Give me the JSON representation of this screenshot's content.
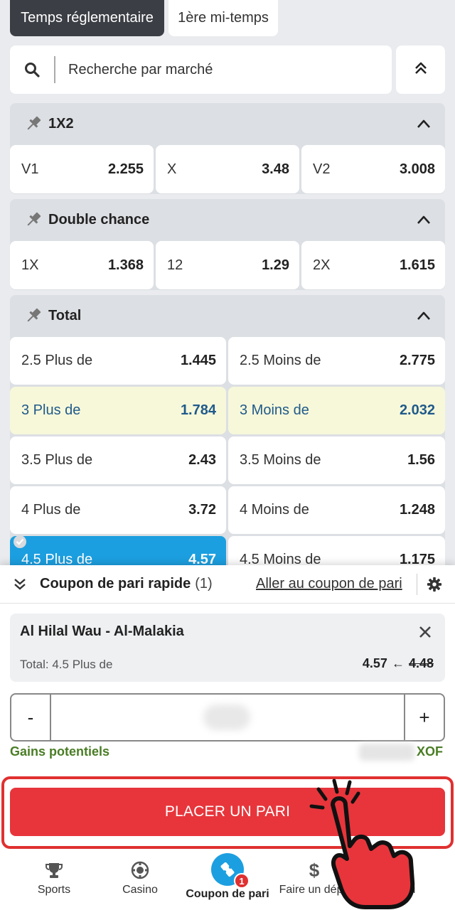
{
  "tabs": [
    {
      "label": "Temps réglementaire",
      "active": true
    },
    {
      "label": "1ère mi-temps",
      "active": false
    }
  ],
  "search": {
    "placeholder": "Recherche par marché",
    "icon": "search-icon"
  },
  "markets": [
    {
      "title": "1X2",
      "rows": [
        [
          {
            "label": "V1",
            "odd": "2.255"
          },
          {
            "label": "X",
            "odd": "3.48"
          },
          {
            "label": "V2",
            "odd": "3.008"
          }
        ]
      ]
    },
    {
      "title": "Double chance",
      "rows": [
        [
          {
            "label": "1X",
            "odd": "1.368"
          },
          {
            "label": "12",
            "odd": "1.29"
          },
          {
            "label": "2X",
            "odd": "1.615"
          }
        ]
      ]
    },
    {
      "title": "Total",
      "rows": [
        [
          {
            "label": "2.5 Plus de",
            "odd": "1.445"
          },
          {
            "label": "2.5 Moins de",
            "odd": "2.775"
          }
        ],
        [
          {
            "label": "3 Plus de",
            "odd": "1.784"
          },
          {
            "label": "3 Moins de",
            "odd": "2.032"
          }
        ],
        [
          {
            "label": "3.5 Plus de",
            "odd": "2.43"
          },
          {
            "label": "3.5 Moins de",
            "odd": "1.56"
          }
        ],
        [
          {
            "label": "4 Plus de",
            "odd": "3.72"
          },
          {
            "label": "4 Moins de",
            "odd": "1.248"
          }
        ],
        [
          {
            "label": "4.5 Plus de",
            "odd": "4.57"
          },
          {
            "label": "4.5 Moins de",
            "odd": "1.175"
          }
        ]
      ]
    }
  ],
  "coupon": {
    "title": "Coupon de pari rapide",
    "count": "(1)",
    "goto_label": "Aller au coupon de pari",
    "bet": {
      "match": "Al Hilal Wau - Al-Malakia",
      "selection": "Total: 4.5 Plus de",
      "new_odd": "4.57",
      "arrow": "←",
      "old_odd": "4.48"
    },
    "minus": "-",
    "plus": "+",
    "gains_label": "Gains potentiels",
    "currency": "XOF",
    "place_label": "PLACER UN PARI"
  },
  "nav": {
    "items": [
      {
        "label": "Sports",
        "icon": "trophy-icon"
      },
      {
        "label": "Casino",
        "icon": "chip-icon"
      },
      {
        "label": "Coupon de pari",
        "icon": "ticket-icon",
        "badge": "1",
        "active": true
      },
      {
        "label": "Faire un dépô",
        "icon": "dollar-icon"
      },
      {
        "label": "u",
        "icon": "menu-icon"
      }
    ]
  },
  "colors": {
    "accent": "#1c9fe0",
    "place_button": "#e7353b",
    "highlight_cell": "#f7f8da",
    "gains_green": "#4a7d25"
  }
}
